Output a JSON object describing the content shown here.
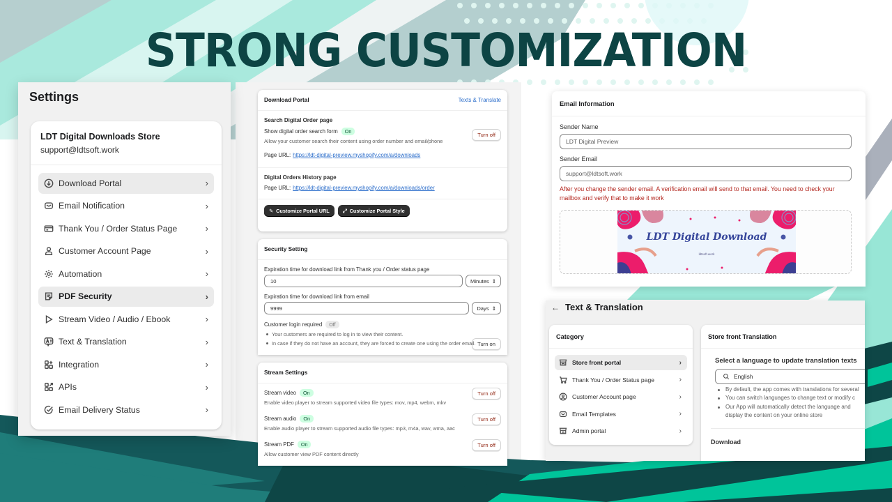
{
  "headline": "STRONG CUSTOMIZATION",
  "colors": {
    "headline": "#0d4444",
    "teal_light": "#a9e9dd",
    "teal_dark": "#14585a",
    "teal_mid": "#1f7d7a",
    "green_accent": "#00c49a",
    "gray_stripe": "#aab0bb"
  },
  "settings": {
    "title": "Settings",
    "store_name": "LDT Digital Downloads Store",
    "store_email": "support@ldtsoft.work",
    "items": [
      {
        "label": "Download Portal",
        "icon": "download-circle-icon",
        "active": true,
        "bold": false
      },
      {
        "label": "Email Notification",
        "icon": "envelope-icon",
        "active": false,
        "bold": false
      },
      {
        "label": "Thank You / Order Status Page",
        "icon": "credit-card-icon",
        "active": false,
        "bold": false
      },
      {
        "label": "Customer Account Page",
        "icon": "person-icon",
        "active": false,
        "bold": false
      },
      {
        "label": "Automation",
        "icon": "gear-automation-icon",
        "active": false,
        "bold": false
      },
      {
        "label": "PDF Security",
        "icon": "note-icon",
        "active": true,
        "bold": true
      },
      {
        "label": "Stream Video / Audio / Ebook",
        "icon": "play-icon",
        "active": false,
        "bold": false
      },
      {
        "label": "Text & Translation",
        "icon": "translate-icon",
        "active": false,
        "bold": false
      },
      {
        "label": "Integration",
        "icon": "apps-plus-icon",
        "active": false,
        "bold": false
      },
      {
        "label": "APIs",
        "icon": "apps-arrow-icon",
        "active": false,
        "bold": false
      },
      {
        "label": "Email Delivery Status",
        "icon": "check-circle-icon",
        "active": false,
        "bold": false
      }
    ]
  },
  "download_portal": {
    "title": "Download Portal",
    "link": "Texts & Translate",
    "search_section_title": "Search Digital Order page",
    "search_form_label": "Show digital order search form",
    "search_form_status": "On",
    "search_form_button": "Turn off",
    "search_form_desc": "Allow your customer search their content using order number and email/phone",
    "page_url_label": "Page URL:",
    "search_page_url": "https://ldt-digital-preview.myshopify.com/a/downloads",
    "history_title": "Digital Orders History page",
    "history_page_url": "https://ldt-digital-preview.myshopify.com/a/downloads/order",
    "btn_customize_url": "Customize Portal URL",
    "btn_customize_style": "Customize Portal Style"
  },
  "security": {
    "title": "Security Setting",
    "field1_label": "Expiration time for download link from Thank you / Order status page",
    "field1_value": "10",
    "field1_unit": "Minutes",
    "field2_label": "Expiration time for download link from email",
    "field2_value": "9999",
    "field2_unit": "Days",
    "login_label": "Customer login required",
    "login_status": "Off",
    "login_button": "Turn on",
    "bullets": [
      "Your customers are required to log in to view their content.",
      "In case if they do not have an account, they are forced to create one using the order email."
    ]
  },
  "stream": {
    "title": "Stream Settings",
    "items": [
      {
        "label": "Stream video",
        "status": "On",
        "button": "Turn off",
        "desc": "Enable video player to stream supported video file types: mov, mp4, webm, mkv"
      },
      {
        "label": "Stream audio",
        "status": "On",
        "button": "Turn off",
        "desc": "Enable audio player to stream supported audio file types: mp3, m4a, wav, wma, aac"
      },
      {
        "label": "Stream PDF",
        "status": "On",
        "button": "Turn off",
        "desc": "Allow customer view PDF content directly"
      }
    ]
  },
  "email_info": {
    "title": "Email Information",
    "sender_name_label": "Sender Name",
    "sender_name_value": "LDT Digital Preview",
    "sender_email_label": "Sender Email",
    "sender_email_value": "support@ldtsoft.work",
    "warning": "After you change the sender email. A verification email will send to that email. You need to check your mailbox and verify that to make it work",
    "banner_title": "LDT Digital Download",
    "banner_subtitle": "ldtsoft.work"
  },
  "text_translation": {
    "title": "Text & Translation",
    "category_title": "Category",
    "categories": [
      {
        "label": "Store front portal",
        "icon": "storefront-icon",
        "active": true
      },
      {
        "label": "Thank You / Order Status page",
        "icon": "cart-icon",
        "active": false
      },
      {
        "label": "Customer Account page",
        "icon": "user-circle-icon",
        "active": false
      },
      {
        "label": "Email Templates",
        "icon": "envelope-icon",
        "active": false
      },
      {
        "label": "Admin portal",
        "icon": "store-icon",
        "active": false
      }
    ],
    "panel_title": "Store front Translation",
    "select_label": "Select a language to update translation texts",
    "language_value": "English",
    "bullets": [
      "By default, the app comes with translations for several",
      "You can switch languages to change text or modify c",
      "Our App will automatically detect the language and",
      "display the content on your online store"
    ],
    "download_label": "Download"
  }
}
